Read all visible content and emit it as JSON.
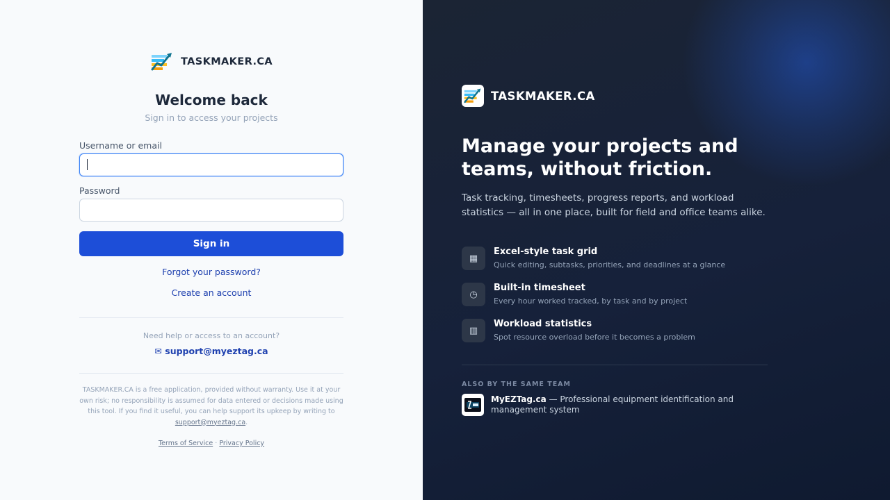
{
  "brand": {
    "name": "TASKMAKER.CA",
    "logo_icon": "chart-logo-icon"
  },
  "login": {
    "title": "Welcome back",
    "subtitle": "Sign in to access your projects",
    "username_label": "Username or email",
    "username_value": "",
    "password_label": "Password",
    "password_value": "",
    "signin_label": "Sign in",
    "forgot_label": "Forgot your password?",
    "create_label": "Create an account"
  },
  "help": {
    "text": "Need help or access to an account?",
    "envelope": "✉",
    "email": "support@myeztag.ca"
  },
  "disclaimer": {
    "text": "TASKMAKER.CA is a free application, provided without warranty. Use it at your own risk; no responsibility is assumed for data entered or decisions made using this tool. If you find it useful, you can help support its upkeep by writing to",
    "link": "support@myeztag.ca",
    "end": "."
  },
  "legal": {
    "terms": "Terms of Service",
    "separator": "·",
    "privacy": "Privacy Policy"
  },
  "hero": {
    "headline": "Manage your projects and teams, without friction.",
    "description": "Task tracking, timesheets, progress reports, and workload statistics — all in one place, built for field and office teams alike."
  },
  "features": [
    {
      "icon": "grid-icon",
      "glyph": "▦",
      "title": "Excel-style task grid",
      "desc": "Quick editing, subtasks, priorities, and deadlines at a glance"
    },
    {
      "icon": "clock-icon",
      "glyph": "◷",
      "title": "Built-in timesheet",
      "desc": "Every hour worked tracked, by task and by project"
    },
    {
      "icon": "bar-chart-icon",
      "glyph": "▥",
      "title": "Workload statistics",
      "desc": "Spot resource overload before it becomes a problem"
    }
  ],
  "also": {
    "label": "ALSO BY THE SAME TEAM",
    "name": "MyEZTag.ca",
    "desc": " — Professional equipment identification and management system"
  },
  "colors": {
    "primary": "#1d4ed8",
    "dark_bg": "#16213a",
    "link": "#1e40af"
  }
}
